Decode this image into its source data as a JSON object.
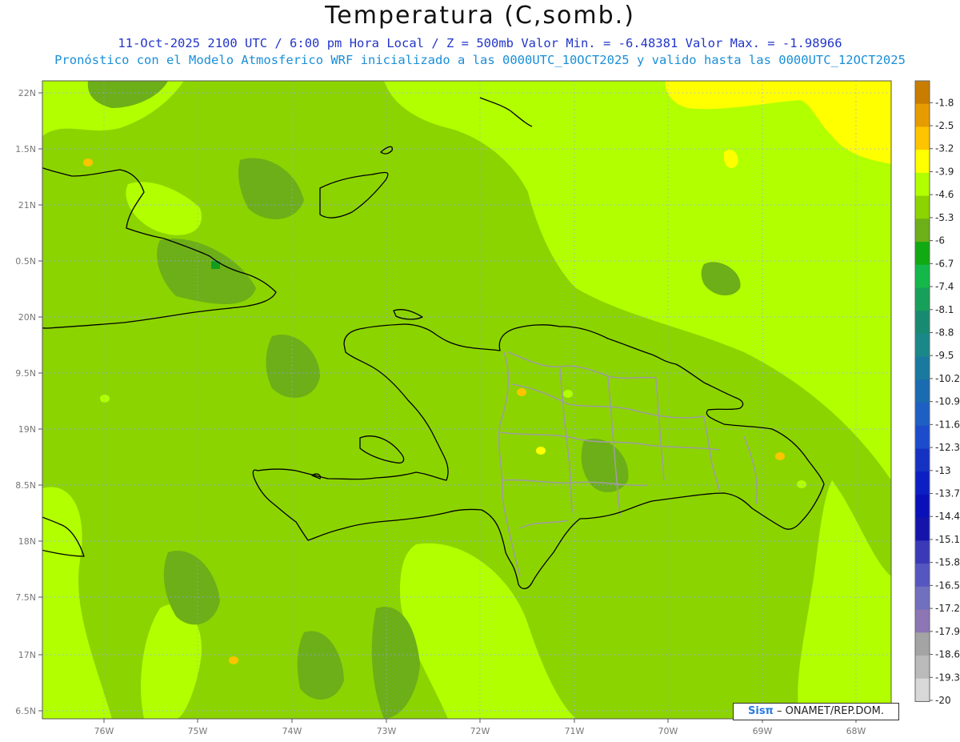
{
  "title": "Temperatura (C,somb.)",
  "subtitle_1": "11-Oct-2025  2100 UTC / 6:00 pm Hora Local / Z = 500mb  Valor Min. = -6.48381  Valor Max. = -1.98966",
  "subtitle_2": "Pronóstico con el Modelo Atmosferico WRF inicializado a las 0000UTC_10OCT2025 y valido hasta las  0000UTC_12OCT2025",
  "map": {
    "lat_labels": [
      "22N",
      "1.5N",
      "21N",
      "0.5N",
      "20N",
      "9.5N",
      "19N",
      "8.5N",
      "18N",
      "7.5N",
      "17N",
      "6.5N"
    ],
    "lon_labels": [
      "76W",
      "75W",
      "74W",
      "73W",
      "72W",
      "71W",
      "70W",
      "69W",
      "68W"
    ],
    "lat_range": [
      16.4,
      22.1
    ],
    "lon_range": [
      -76.65,
      -67.6
    ],
    "grid": "dotted",
    "field_colors": {
      "band_-5.3": "#8cd400",
      "band_-4.6": "#b2ff00",
      "band_-6": "#6daf18",
      "band_-3.9": "#ffff00",
      "band_-3.2": "#ffc400",
      "band_-6.7": "#139d1f"
    },
    "coast_color": "#000000",
    "province_color": "#9e9e9e"
  },
  "colorbar": {
    "labels": [
      "-1.8",
      "-2.5",
      "-3.2",
      "-3.9",
      "-4.6",
      "-5.3",
      "-6",
      "-6.7",
      "-7.4",
      "-8.1",
      "-8.8",
      "-9.5",
      "-10.2",
      "-10.9",
      "-11.6",
      "-12.3",
      "-13",
      "-13.7",
      "-14.4",
      "-15.1",
      "-15.8",
      "-16.5",
      "-17.2",
      "-17.9",
      "-18.6",
      "-19.3",
      "-20"
    ],
    "colors": [
      "#c87d00",
      "#e69c00",
      "#ffc400",
      "#ffff00",
      "#b2ff00",
      "#8cd400",
      "#6daf18",
      "#12aa12",
      "#14b84a",
      "#17a05a",
      "#198a72",
      "#1a8788",
      "#19799e",
      "#1a6bb0",
      "#1d5fc2",
      "#1c4ccc",
      "#1532c2",
      "#0c1fc2",
      "#0a10b8",
      "#1414aa",
      "#3a3ab8",
      "#5656c0",
      "#7070be",
      "#8c76b4",
      "#a4a4a4",
      "#bababa",
      "#d8d8d8"
    ]
  },
  "watermark": {
    "sis": "Sisπ",
    "org": " – ONAMET/REP.DOM."
  }
}
